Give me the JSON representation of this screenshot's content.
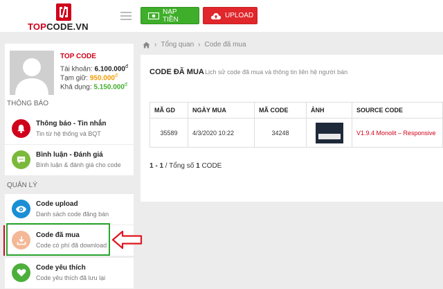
{
  "header": {
    "logo_top": "TOP",
    "logo_rest": "CODE.VN",
    "deposit_label": "NẠP TIỀN",
    "upload_label": "UPLOAD"
  },
  "profile": {
    "name": "TOP CODE",
    "balance_label": "Tài khoản:",
    "balance_value": "6.100.000",
    "hold_label": "Tạm giữ:",
    "hold_value": "950.000",
    "available_label": "Khả dụng:",
    "available_value": "5.150.000",
    "currency": "đ"
  },
  "sidebar": {
    "section_notify": "THÔNG BÁO",
    "section_manage": "QUẢN LÝ",
    "items": [
      {
        "title": "Thông báo - Tin nhắn",
        "sub": "Tin từ hệ thống và BQT"
      },
      {
        "title": "Bình luận - Đánh giá",
        "sub": "Bình luận & đánh giá cho code"
      },
      {
        "title": "Code upload",
        "sub": "Danh sách code đăng bán"
      },
      {
        "title": "Code đã mua",
        "sub": "Code có phí đã download"
      },
      {
        "title": "Code yêu thích",
        "sub": "Code yêu thích đã lưu lại"
      }
    ]
  },
  "breadcrumb": {
    "overview": "Tổng quan",
    "current": "Code đã mua"
  },
  "panel": {
    "title": "CODE ĐÃ MUA",
    "desc": "Lịch sử code đã mua và thông tin liên hệ người bán"
  },
  "table": {
    "headers": [
      "MÃ GD",
      "NGÀY MUA",
      "MÃ CODE",
      "ẢNH",
      "SOURCE CODE"
    ],
    "rows": [
      {
        "id": "35589",
        "date": "4/3/2020 10:22",
        "code": "34248",
        "source": "V1.9.4 Monolit – Responsive"
      }
    ]
  },
  "pager": {
    "range": "1 - 1",
    "text": "/ Tổng số",
    "total": "1",
    "unit": "CODE"
  },
  "colors": {
    "brand_red": "#d0021b",
    "green": "#3fae2a",
    "highlight": "#2aa52f"
  }
}
